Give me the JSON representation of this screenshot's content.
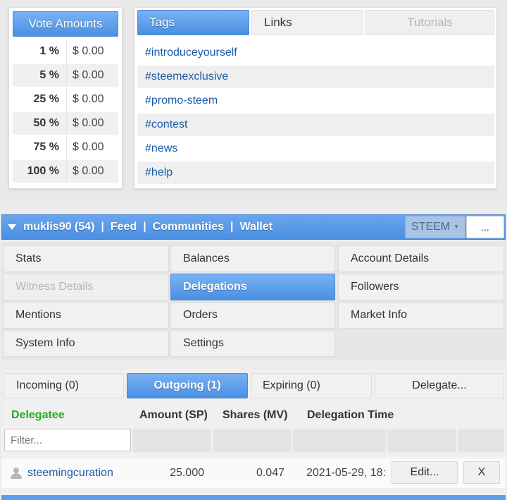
{
  "vote_amounts": {
    "title": "Vote Amounts",
    "rows": [
      {
        "percent": "1 %",
        "amount": "$ 0.00"
      },
      {
        "percent": "5 %",
        "amount": "$ 0.00"
      },
      {
        "percent": "25 %",
        "amount": "$ 0.00"
      },
      {
        "percent": "50 %",
        "amount": "$ 0.00"
      },
      {
        "percent": "75 %",
        "amount": "$ 0.00"
      },
      {
        "percent": "100 %",
        "amount": "$ 0.00"
      }
    ]
  },
  "tags_panel": {
    "tabs": [
      {
        "label": "Tags",
        "state": "active"
      },
      {
        "label": "Links",
        "state": "normal"
      },
      {
        "label": "Tutorials",
        "state": "disabled"
      }
    ],
    "tags": [
      "#introduceyourself",
      "#steemexclusive",
      "#promo-steem",
      "#contest",
      "#news",
      "#help"
    ]
  },
  "account_bar": {
    "user": "muklis90 (54)",
    "links": [
      "Feed",
      "Communities",
      "Wallet"
    ],
    "separator": "|",
    "currency_select": "STEEM",
    "more_label": "..."
  },
  "menu": {
    "items": [
      {
        "label": "Stats",
        "state": "normal"
      },
      {
        "label": "Balances",
        "state": "normal"
      },
      {
        "label": "Account Details",
        "state": "normal"
      },
      {
        "label": "Witness Details",
        "state": "disabled"
      },
      {
        "label": "Delegations",
        "state": "active"
      },
      {
        "label": "Followers",
        "state": "normal"
      },
      {
        "label": "Mentions",
        "state": "normal"
      },
      {
        "label": "Orders",
        "state": "normal"
      },
      {
        "label": "Market Info",
        "state": "normal"
      },
      {
        "label": "System Info",
        "state": "normal"
      },
      {
        "label": "Settings",
        "state": "normal"
      }
    ]
  },
  "delegations": {
    "tabs": [
      {
        "label": "Incoming (0)",
        "state": "normal"
      },
      {
        "label": "Outgoing (1)",
        "state": "active"
      },
      {
        "label": "Expiring (0)",
        "state": "normal"
      },
      {
        "label": "Delegate...",
        "state": "normal"
      }
    ],
    "columns": [
      "Delegatee",
      "Amount (SP)",
      "Shares (MV)",
      "Delegation Time"
    ],
    "filter_placeholder": "Filter...",
    "rows": [
      {
        "delegatee": "steemingcuration",
        "amount": "25.000",
        "shares": "0.047",
        "time": "2021-05-29, 18:",
        "edit_label": "Edit...",
        "remove_label": "X"
      }
    ]
  },
  "colors": {
    "accent_blue": "#4a90e2",
    "link_blue": "#1a5aa8",
    "delegatee_header": "#22aa22"
  },
  "icons": [
    "dropdown-triangle-icon",
    "select-arrow-icon",
    "user-icon"
  ]
}
